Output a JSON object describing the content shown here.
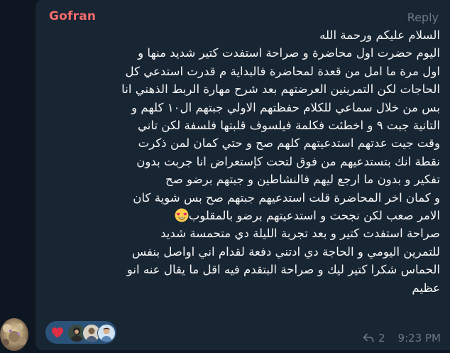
{
  "message": {
    "sender": "Gofran",
    "reply_label": "Reply",
    "lines": [
      "السلام عليكم ورحمة الله",
      "اليوم حضرت اول محاضرة و صراحة استفدت كتير شديد منها و",
      "اول مرة ما امل من قعدة لمحاضرة فالبداية م قدرت استدعي كل",
      "الحاجات لكن التمرينين العرضتهم بعد شرح مهارة الربط الذهني انا",
      "بس من خلال سماعي للكلام حفظتهم الاولي جبتهم ال١٠ كلهم و",
      "التانية جبت ٩ و اخطئت فكلمة فيلسوف قلبتها فلسفة لكن تاني",
      "وقت جيت عدتهم استدعيتهم كلهم صح و حتي كمان لمن ذكرت",
      "نقطة انك بتستدعيهم من فوق لتحت كإستعراض انا جربت بدون",
      "تفكير و بدون ما ارجع ليهم فالنشاطين و جبتهم برضو صح",
      "و كمان اخر المحاضرة قلت استدعيهم جبتهم صح بس شوية كان",
      "الامر صعب لكن نجحت و استدعيتهم برضو بالمقلوب",
      "صراحة استفدت كتير و بعد تجربة الليلة دي متحمسة شديد",
      "للتمرين اليومي و الحاجة دي ادتني دفعة لقدام اني اواصل بنفس",
      "الحماس شكرا كتير ليك و صراحة البتقدم فيه اقل ما يقال عنه انو",
      "عظيم"
    ],
    "emoji": "heart-eyes-emoji",
    "reaction": "red-heart-emoji",
    "forward_count": "2",
    "time": "9:23 PM"
  },
  "colors": {
    "chat_background": "#0e1621",
    "bubble": "#182533",
    "sender_name": "#f56b6b",
    "meta_text": "#6c7883",
    "message_text": "#f5f5f5",
    "reaction_pill": "#2b5278"
  }
}
